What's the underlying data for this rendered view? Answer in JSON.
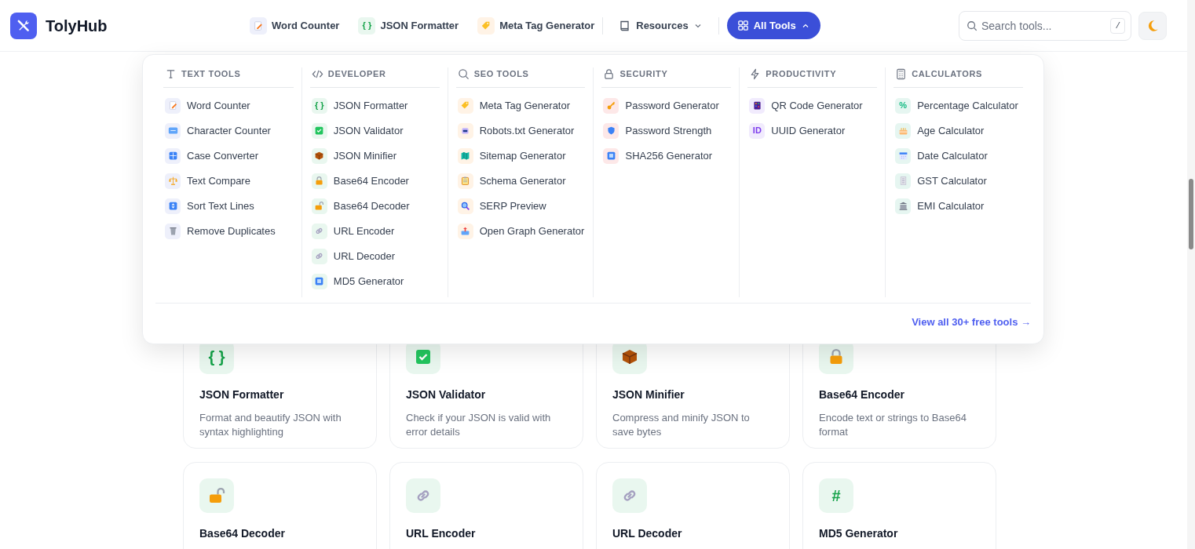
{
  "header": {
    "brand": "TolyHub",
    "quick_links": [
      {
        "label": "Word Counter"
      },
      {
        "label": "JSON Formatter",
        "glyph": "{ }"
      },
      {
        "label": "Meta Tag Generator"
      }
    ],
    "resources": {
      "label": "Resources",
      "expanded": false
    },
    "all_tools": {
      "label": "All Tools",
      "expanded": true
    },
    "search": {
      "placeholder": "Search tools...",
      "shortcut": "/"
    }
  },
  "menu": {
    "sections": [
      {
        "title": "TEXT TOOLS",
        "items": [
          {
            "label": "Word Counter"
          },
          {
            "label": "Character Counter"
          },
          {
            "label": "Case Converter"
          },
          {
            "label": "Text Compare"
          },
          {
            "label": "Sort Text Lines"
          },
          {
            "label": "Remove Duplicates"
          }
        ]
      },
      {
        "title": "DEVELOPER",
        "items": [
          {
            "label": "JSON Formatter",
            "glyph": "{ }"
          },
          {
            "label": "JSON Validator"
          },
          {
            "label": "JSON Minifier"
          },
          {
            "label": "Base64 Encoder"
          },
          {
            "label": "Base64 Decoder"
          },
          {
            "label": "URL Encoder"
          },
          {
            "label": "URL Decoder"
          },
          {
            "label": "MD5 Generator"
          }
        ]
      },
      {
        "title": "SEO TOOLS",
        "items": [
          {
            "label": "Meta Tag Generator"
          },
          {
            "label": "Robots.txt Generator"
          },
          {
            "label": "Sitemap Generator"
          },
          {
            "label": "Schema Generator"
          },
          {
            "label": "SERP Preview"
          },
          {
            "label": "Open Graph Generator"
          }
        ]
      },
      {
        "title": "SECURITY",
        "items": [
          {
            "label": "Password Generator"
          },
          {
            "label": "Password Strength"
          },
          {
            "label": "SHA256 Generator"
          }
        ]
      },
      {
        "title": "PRODUCTIVITY",
        "items": [
          {
            "label": "QR Code Generator"
          },
          {
            "label": "UUID Generator",
            "glyph": "ID"
          }
        ]
      },
      {
        "title": "CALCULATORS",
        "items": [
          {
            "label": "Percentage Calculator",
            "glyph": "%"
          },
          {
            "label": "Age Calculator"
          },
          {
            "label": "Date Calculator"
          },
          {
            "label": "GST Calculator"
          },
          {
            "label": "EMI Calculator"
          }
        ]
      }
    ],
    "footer_link": "View all 30+ free tools →"
  },
  "cards": [
    {
      "title": "JSON Formatter",
      "description": "Format and beautify JSON with syntax highlighting",
      "glyph": "{ }"
    },
    {
      "title": "JSON Validator",
      "description": "Check if your JSON is valid with error details"
    },
    {
      "title": "JSON Minifier",
      "description": "Compress and minify JSON to save bytes"
    },
    {
      "title": "Base64 Encoder",
      "description": "Encode text or strings to Base64 format"
    },
    {
      "title": "Base64 Decoder"
    },
    {
      "title": "URL Encoder"
    },
    {
      "title": "URL Decoder"
    },
    {
      "title": "MD5 Generator",
      "glyph": "#"
    }
  ]
}
